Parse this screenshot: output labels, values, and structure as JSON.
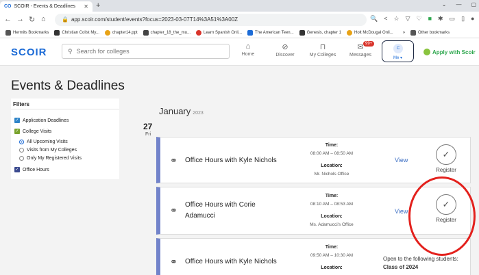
{
  "browser": {
    "tab_title": "SCOIR - Events & Deadlines",
    "tab_favicon": "CO",
    "url": "app.scoir.com/student/events?focus=2023-03-07T14%3A51%3A00Z",
    "bookmarks": [
      {
        "label": "Hermits Bookmarks",
        "color": "#555555"
      },
      {
        "label": "Christian Colist My...",
        "color": "#333333"
      },
      {
        "label": "chapter14.ppt",
        "color": "#e8a317"
      },
      {
        "label": "chapter_18_the_mu...",
        "color": "#444444"
      },
      {
        "label": "Learn Spanish Onli...",
        "color": "#d9342b"
      },
      {
        "label": "The American Teen...",
        "color": "#1c6bd6"
      },
      {
        "label": "Genesis, chapter 1",
        "color": "#333333"
      },
      {
        "label": "Holt McDougal Onli...",
        "color": "#e8a317"
      }
    ],
    "bookmarks_more": "»",
    "other_bookmarks": "Other bookmarks"
  },
  "header": {
    "logo": "SCOIR",
    "search_placeholder": "Search for colleges",
    "nav": [
      {
        "label": "Home",
        "icon": "home-icon"
      },
      {
        "label": "Discover",
        "icon": "compass-icon"
      },
      {
        "label": "My Colleges",
        "icon": "bookmark-icon"
      },
      {
        "label": "Messages",
        "icon": "mail-icon",
        "badge": "99+"
      }
    ],
    "avatar_initial": "C",
    "me_label": "Me ▾",
    "apply_label": "Apply with Scoir"
  },
  "page": {
    "title": "Events & Deadlines"
  },
  "filters": {
    "title": "Filters",
    "items": [
      {
        "label": "Application Deadlines",
        "type": "checkbox",
        "checked": true,
        "color": "#2f84c8"
      },
      {
        "label": "College Visits",
        "type": "checkbox",
        "checked": true,
        "color": "#7aa32e"
      },
      {
        "label": "All Upcoming Visits",
        "type": "radio",
        "checked": true
      },
      {
        "label": "Visits from My Colleges",
        "type": "radio",
        "checked": false
      },
      {
        "label": "Only My Registered Visits",
        "type": "radio",
        "checked": false
      },
      {
        "label": "Office Hours",
        "type": "checkbox",
        "checked": true,
        "color": "#3b4a8f"
      }
    ]
  },
  "events": {
    "month": "January",
    "year": "2023",
    "day_number": "27",
    "day_name": "Fri",
    "time_label": "Time:",
    "location_label": "Location:",
    "cards": [
      {
        "title": "Office Hours with Kyle Nichols",
        "time": "08:00 AM – 08:50 AM",
        "location": "Mr. Nichols Office",
        "view": "View",
        "register": "Register",
        "check": "✓"
      },
      {
        "title": "Office Hours with Corie Adamucci",
        "time": "08:10 AM – 08:53 AM",
        "location": "Ms. Adamucci's Office",
        "view": "View",
        "register": "Register",
        "check": "✓"
      },
      {
        "title": "Office Hours with Kyle Nichols",
        "time": "09:50 AM – 10:30 AM",
        "location": "",
        "open_text": "Open to the following students:",
        "class_text": "Class of 2024"
      }
    ]
  },
  "colors": {
    "brand": "#1c6bd6",
    "card_accent": "#7283ca",
    "annotation": "#e3211d",
    "apply_green": "#2fa84f"
  }
}
